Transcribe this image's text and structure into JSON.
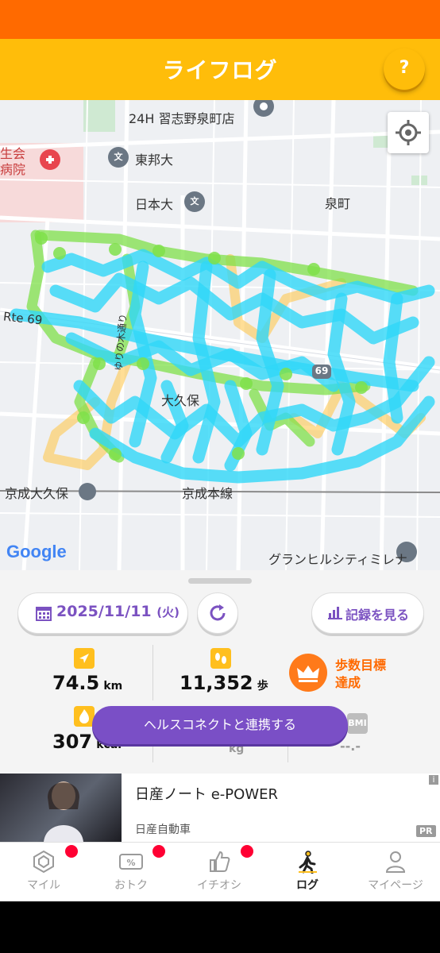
{
  "header": {
    "title": "ライフログ",
    "help_label": "?"
  },
  "map": {
    "labels": {
      "place_top": "24H 習志野泉町店",
      "hospital": "生会\n病院",
      "toho": "東邦大",
      "nihon": "日本大",
      "izumi": "泉町",
      "route": "Rte 69",
      "route_badge": "69",
      "yurinoki": "ゆりの木通り",
      "okubo": "大久保",
      "station": "京成大久保",
      "line": "京成本線",
      "granhills": "グランヒルシティミレナ",
      "google": "Google"
    }
  },
  "controls": {
    "date": "2025/11/11",
    "weekday": "(火)",
    "records_label": "記録を見る"
  },
  "stats": {
    "distance": {
      "value": "74.5",
      "unit": "km"
    },
    "steps": {
      "value": "11,352",
      "unit": "歩"
    },
    "calories": {
      "value": "307",
      "unit": "kcal"
    },
    "weight_unit": "kg",
    "bmi_label": "BMI",
    "bmi_value": "--.-",
    "goal_text": "歩数目標\n達成"
  },
  "health_button": "ヘルスコネクトと連携する",
  "ad": {
    "title": "日産ノート e-POWER",
    "advertiser": "日産自動車",
    "pr": "PR",
    "info": "i"
  },
  "tabs": [
    {
      "label": "マイル",
      "icon": "mile-icon",
      "badge": true
    },
    {
      "label": "おトク",
      "icon": "coupon-icon",
      "badge": true
    },
    {
      "label": "イチオシ",
      "icon": "thumbs-up-icon",
      "badge": true
    },
    {
      "label": "ログ",
      "icon": "walking-icon",
      "badge": false,
      "active": true
    },
    {
      "label": "マイページ",
      "icon": "person-icon",
      "badge": false
    }
  ],
  "colors": {
    "status": "#ff6a00",
    "header": "#ffbd0a",
    "accent": "#7a4fc6",
    "route": "#33d6f5",
    "goal": "#ff6a00"
  }
}
